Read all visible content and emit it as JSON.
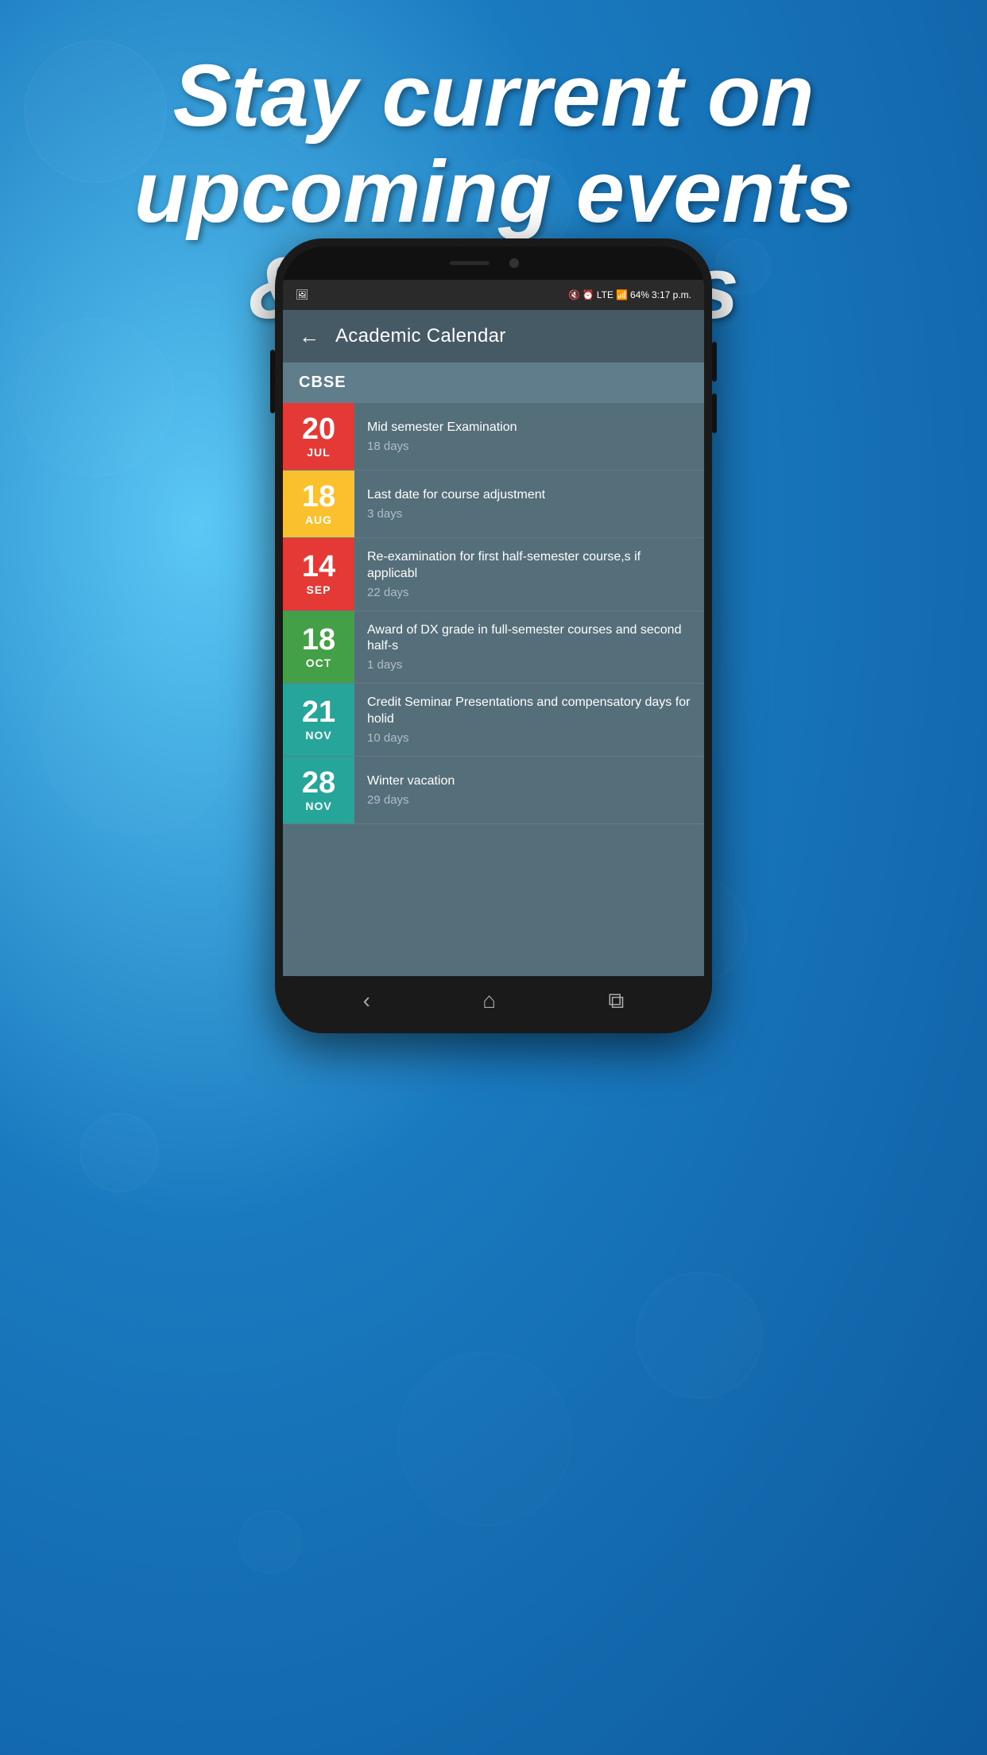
{
  "background": {
    "gradient": "blue-bokeh"
  },
  "header": {
    "line1": "Stay current on",
    "line2": "upcoming events",
    "line3": "& deadlines"
  },
  "statusBar": {
    "time": "3:17 p.m.",
    "battery": "64%",
    "signal": "LTE"
  },
  "appBar": {
    "title": "Academic Calendar",
    "backLabel": "←"
  },
  "sectionHeader": "CBSE",
  "events": [
    {
      "day": "20",
      "month": "JUL",
      "colorClass": "bg-red",
      "title": "Mid semester Examination",
      "days": "18 days"
    },
    {
      "day": "18",
      "month": "AUG",
      "colorClass": "bg-yellow",
      "title": "Last date for course adjustment",
      "days": "3 days"
    },
    {
      "day": "14",
      "month": "SEP",
      "colorClass": "bg-red2",
      "title": "Re-examination for first half-semester course,s if applicabl",
      "days": "22 days"
    },
    {
      "day": "18",
      "month": "OCT",
      "colorClass": "bg-green",
      "title": "Award of DX grade in full-semester courses and second half-s",
      "days": "1 days"
    },
    {
      "day": "21",
      "month": "NOV",
      "colorClass": "bg-teal",
      "title": "Credit Seminar Presentations and compensatory days for holid",
      "days": "10 days"
    },
    {
      "day": "28",
      "month": "NOV",
      "colorClass": "bg-teal2",
      "title": "Winter vacation",
      "days": "29 days"
    }
  ],
  "bottomNav": {
    "back": "‹",
    "home": "⌂",
    "recents": "⧉"
  }
}
